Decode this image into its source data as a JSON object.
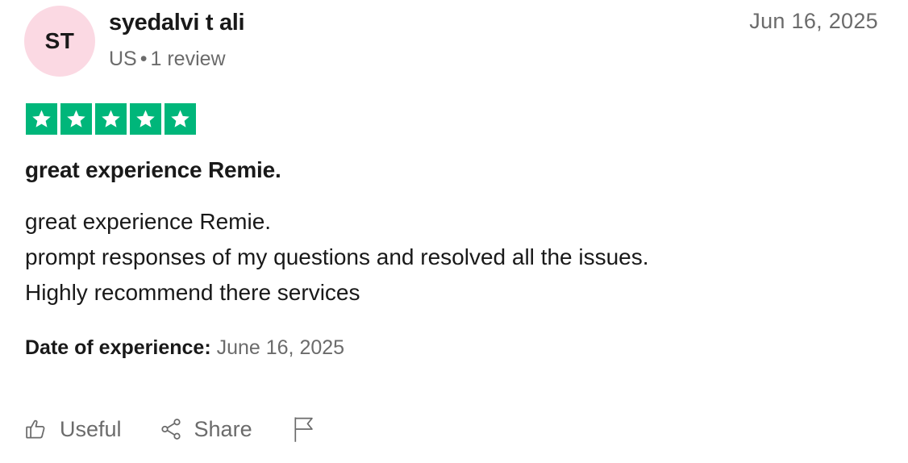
{
  "reviewer": {
    "initials": "ST",
    "name": "syedalvi t ali",
    "country": "US",
    "separator": "•",
    "review_count": "1 review"
  },
  "review": {
    "date": "Jun 16, 2025",
    "rating": 5,
    "rating_max": 5,
    "star_color": "#00b67a",
    "title": "great experience Remie.",
    "body_lines": [
      "great experience Remie.",
      "prompt responses of my questions and resolved all the issues.",
      "Highly recommend there services"
    ],
    "experience_label": "Date of experience:",
    "experience_date": "June 16, 2025"
  },
  "actions": {
    "useful_label": "Useful",
    "share_label": "Share",
    "useful_icon": "thumbs-up-icon",
    "share_icon": "share-icon",
    "report_icon": "flag-icon"
  },
  "colors": {
    "avatar_bg": "#fbd9e3",
    "text_primary": "#191919",
    "text_secondary": "#6b6b6b"
  }
}
